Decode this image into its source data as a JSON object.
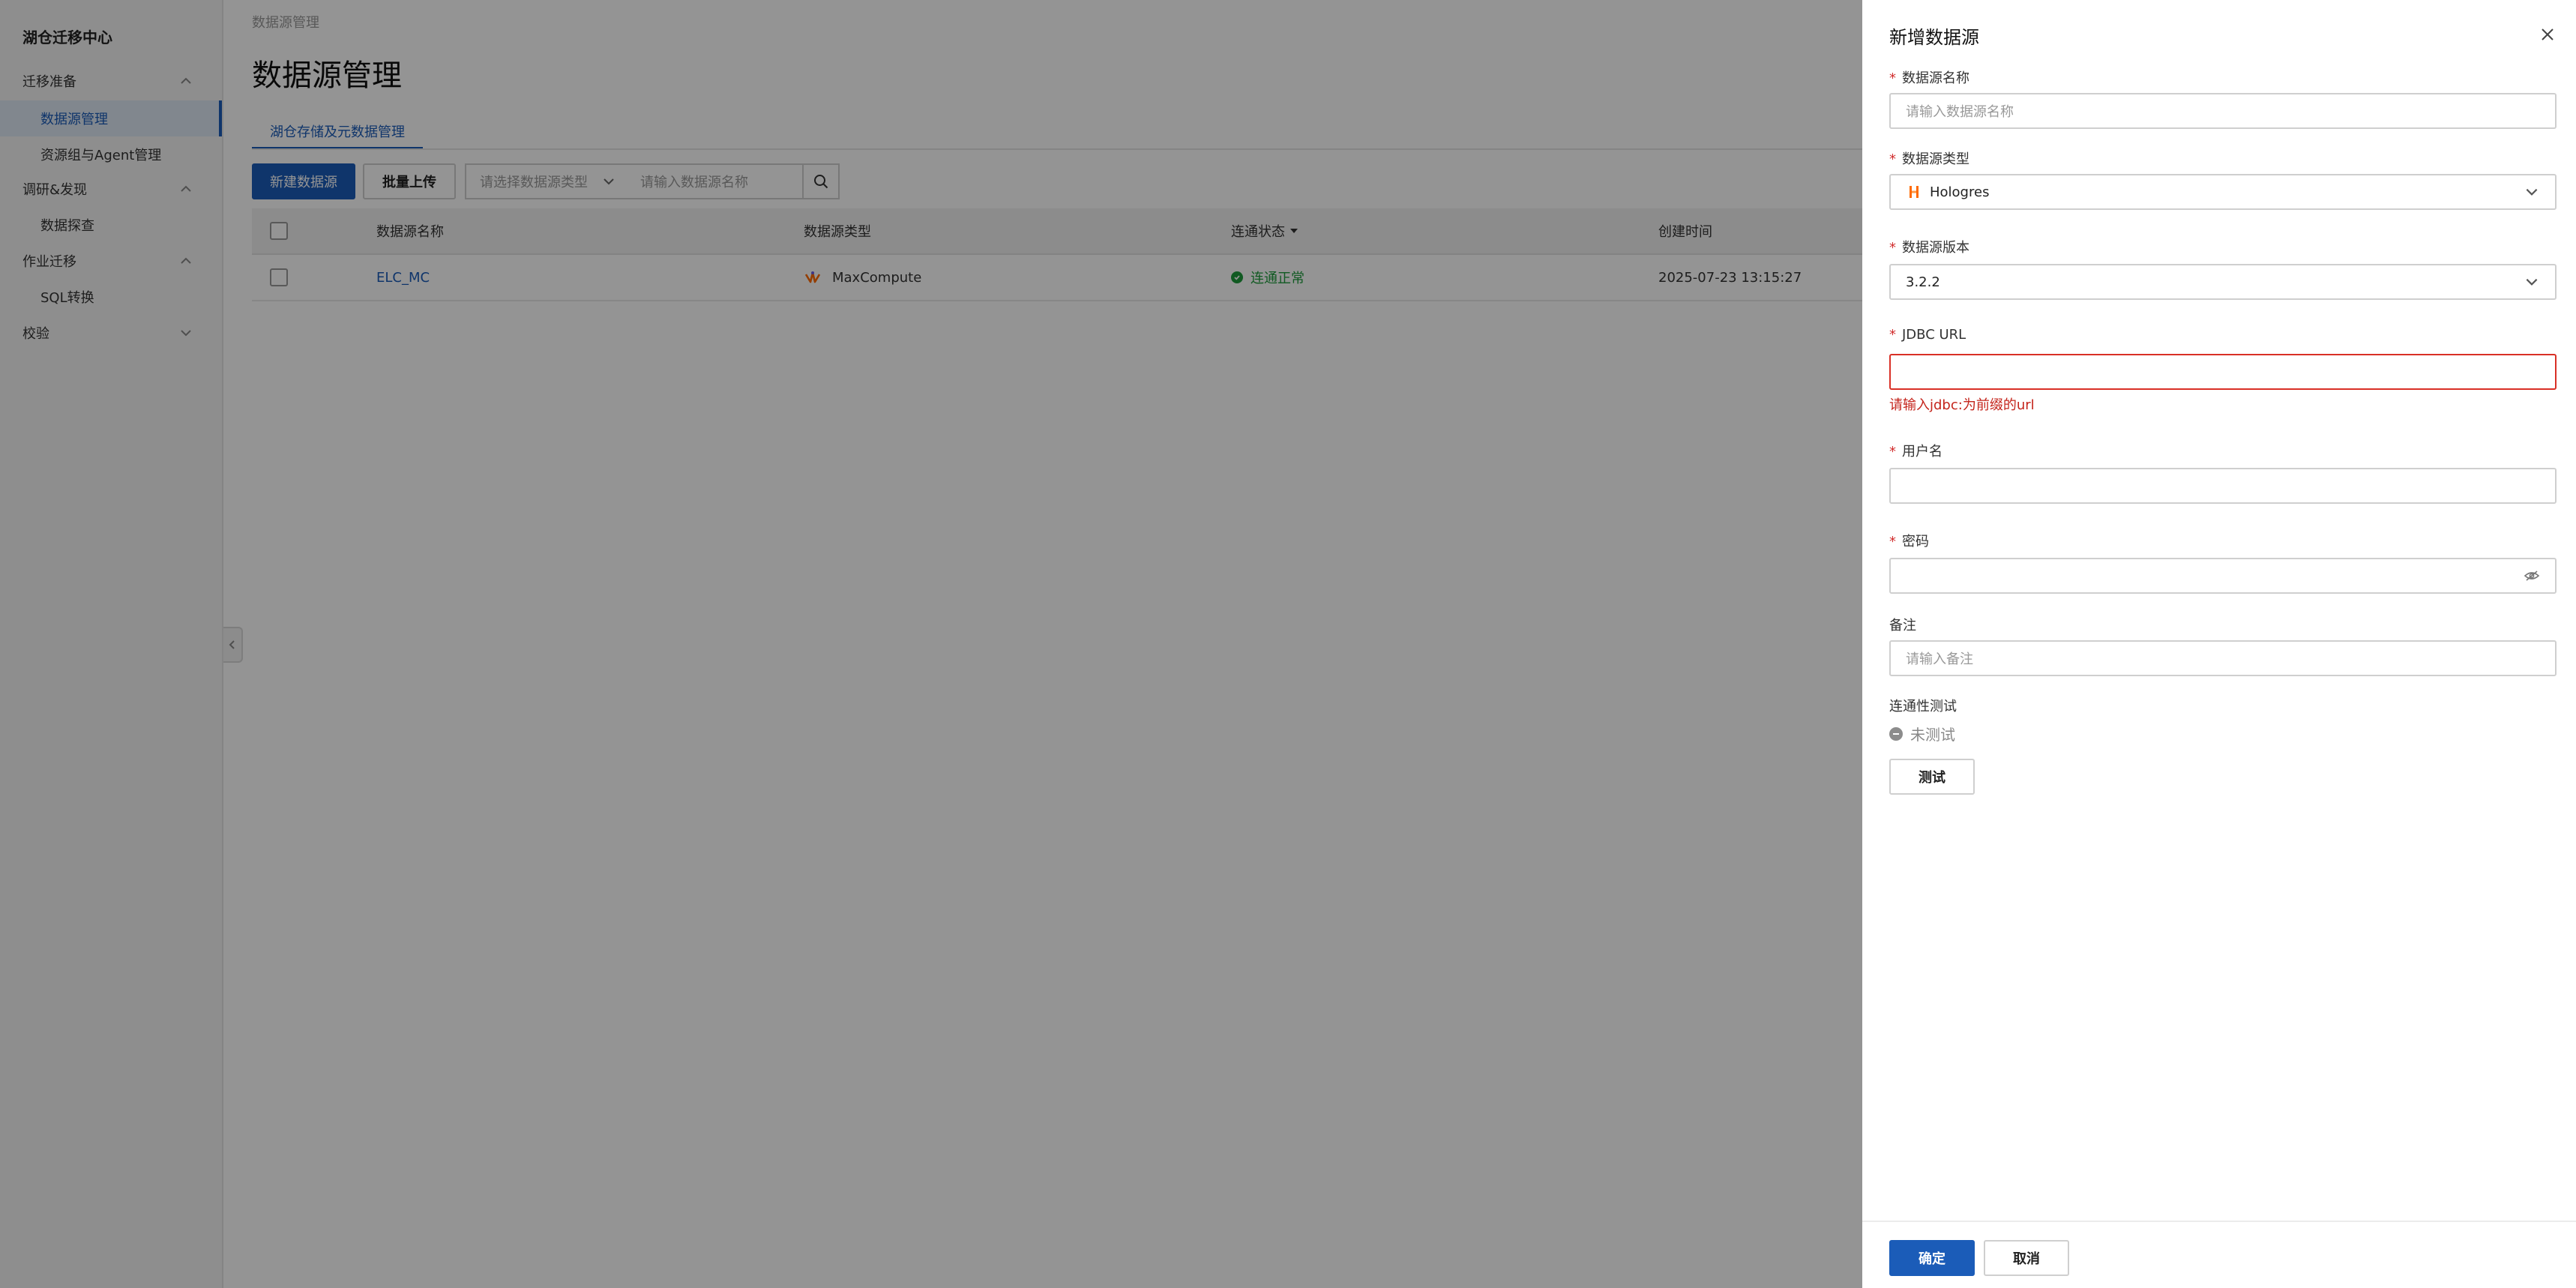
{
  "app": {
    "title": "湖仓迁移中心"
  },
  "sidebar": {
    "groups": [
      {
        "label": "迁移准备",
        "items": [
          "数据源管理",
          "资源组与Agent管理"
        ]
      },
      {
        "label": "调研&发现",
        "items": [
          "数据探查"
        ]
      },
      {
        "label": "作业迁移",
        "items": [
          "SQL转换"
        ]
      },
      {
        "label": "校验",
        "items": []
      }
    ]
  },
  "main": {
    "breadcrumb": "数据源管理",
    "title": "数据源管理",
    "tab": "湖仓存储及元数据管理",
    "toolbar": {
      "new_label": "新建数据源",
      "upload_label": "批量上传",
      "type_placeholder": "请选择数据源类型",
      "name_placeholder": "请输入数据源名称"
    },
    "table": {
      "columns": [
        "数据源名称",
        "数据源类型",
        "连通状态",
        "创建时间"
      ],
      "rows": [
        {
          "name": "ELC_MC",
          "type": "MaxCompute",
          "status": "连通正常",
          "created": "2025-07-23 13:15:27"
        }
      ]
    }
  },
  "drawer": {
    "title": "新增数据源",
    "fields": {
      "name": {
        "label": "数据源名称",
        "placeholder": "请输入数据源名称"
      },
      "type": {
        "label": "数据源类型",
        "value": "Hologres"
      },
      "version": {
        "label": "数据源版本",
        "value": "3.2.2"
      },
      "jdbc": {
        "label": "JDBC URL",
        "value": "",
        "error": "请输入jdbc:为前缀的url"
      },
      "user": {
        "label": "用户名",
        "value": ""
      },
      "password": {
        "label": "密码",
        "value": ""
      },
      "remark": {
        "label": "备注",
        "placeholder": "请输入备注"
      }
    },
    "connectivity": {
      "label": "连通性测试",
      "status": "未测试",
      "test_label": "测试"
    },
    "footer": {
      "confirm_label": "确定",
      "cancel_label": "取消"
    }
  },
  "colors": {
    "primary": "#1b5cb8",
    "success": "#1e9b3c",
    "error": "#d93026",
    "hologres": "#ff6a00"
  }
}
